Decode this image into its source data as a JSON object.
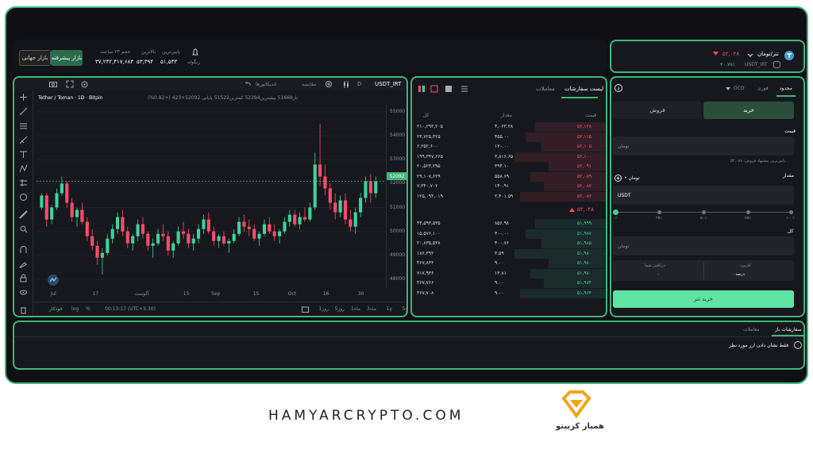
{
  "topbar": {
    "market_global": "بازار جهانی",
    "market_pro": "بازار پیشرفته",
    "vol_label": "حجم ۲۴ ساعت",
    "vol": "۳۷,۲۴۲,۴۱۷,۶۸۳",
    "high_label": "بالاترین",
    "high": "۵۳,۳۹۴",
    "low_label": "پایین‌ترین",
    "low": "۵۱,۵۳۳",
    "wallet": "زنگوله"
  },
  "pair": {
    "name": "تتر/تومان",
    "code": "USDT_IRT",
    "price": "۵۲,۰۲۸",
    "change": "+۰.۷۸٪"
  },
  "chart": {
    "symbol": "USDT_IRT",
    "interval": "D",
    "compare": "مقایسه",
    "indicators": "اندیکاتورها",
    "title": "Tether / Toman · 1D · Bitpin",
    "ohlc_prefix": "باز",
    "ohlc": "باز51669 بیشترین52294 کمترین51522 پایانی 52092+423 (+0.82%)",
    "last": "52092",
    "yticks": [
      "55000",
      "54000",
      "53000",
      "52000",
      "51000",
      "50000",
      "49000",
      "48000"
    ],
    "xticks": [
      "Jul",
      "17",
      "آگوست",
      "15",
      "Sep",
      "15",
      "Oct",
      "16",
      "30"
    ],
    "ranges": [
      "5y",
      "1y",
      "3ماه",
      "1ماه",
      "5روز",
      "1روز"
    ],
    "time": "00:13:17 (UTC+3:30)",
    "opts": [
      "%",
      "log",
      "خودکار"
    ],
    "candles": [
      [
        51.0,
        51.6,
        50.9,
        51.5
      ],
      [
        51.5,
        51.6,
        50.2,
        50.5
      ],
      [
        50.5,
        51.1,
        50.3,
        51.0
      ],
      [
        51.0,
        51.8,
        50.9,
        51.6
      ],
      [
        51.6,
        52.3,
        51.5,
        52.0
      ],
      [
        52.0,
        52.1,
        51.0,
        51.2
      ],
      [
        51.2,
        51.4,
        50.4,
        50.6
      ],
      [
        50.6,
        51.0,
        50.2,
        50.9
      ],
      [
        50.9,
        51.2,
        50.3,
        50.4
      ],
      [
        50.4,
        50.6,
        49.6,
        49.8
      ],
      [
        49.8,
        50.1,
        49.2,
        49.4
      ],
      [
        49.4,
        49.6,
        48.6,
        48.9
      ],
      [
        48.9,
        49.3,
        48.2,
        49.1
      ],
      [
        49.1,
        49.9,
        49.0,
        49.7
      ],
      [
        49.7,
        50.3,
        49.5,
        50.1
      ],
      [
        50.1,
        50.8,
        49.9,
        50.6
      ],
      [
        50.6,
        50.9,
        49.8,
        50.0
      ],
      [
        50.0,
        50.2,
        49.3,
        49.5
      ],
      [
        49.5,
        49.9,
        49.2,
        49.8
      ],
      [
        49.8,
        50.5,
        49.6,
        50.3
      ],
      [
        50.3,
        50.6,
        49.7,
        49.9
      ],
      [
        49.9,
        50.0,
        49.2,
        49.4
      ],
      [
        49.4,
        49.7,
        48.9,
        49.5
      ],
      [
        49.5,
        50.1,
        49.4,
        49.9
      ],
      [
        49.9,
        50.3,
        49.6,
        49.8
      ],
      [
        49.8,
        50.0,
        49.0,
        49.2
      ],
      [
        49.2,
        49.6,
        48.9,
        49.5
      ],
      [
        49.5,
        50.2,
        49.4,
        50.0
      ],
      [
        50.0,
        50.4,
        49.7,
        49.9
      ],
      [
        49.9,
        50.1,
        49.3,
        49.5
      ],
      [
        49.5,
        49.9,
        49.2,
        49.7
      ],
      [
        49.7,
        50.3,
        49.5,
        50.1
      ],
      [
        50.1,
        50.7,
        49.9,
        50.5
      ],
      [
        50.5,
        50.8,
        49.9,
        50.0
      ],
      [
        50.0,
        50.2,
        49.4,
        49.6
      ],
      [
        49.6,
        49.9,
        49.3,
        49.8
      ],
      [
        49.8,
        50.0,
        49.4,
        49.5
      ],
      [
        49.5,
        49.7,
        49.1,
        49.6
      ],
      [
        49.6,
        50.1,
        49.5,
        49.9
      ],
      [
        49.9,
        50.6,
        49.8,
        50.4
      ],
      [
        50.4,
        50.7,
        50.0,
        50.2
      ],
      [
        50.2,
        50.5,
        49.8,
        50.1
      ],
      [
        50.1,
        50.3,
        49.6,
        49.7
      ],
      [
        49.7,
        50.0,
        49.4,
        49.9
      ],
      [
        49.9,
        50.5,
        49.8,
        50.3
      ],
      [
        50.3,
        50.6,
        49.9,
        50.0
      ],
      [
        50.0,
        50.3,
        49.6,
        49.8
      ],
      [
        49.8,
        50.1,
        49.5,
        50.0
      ],
      [
        50.0,
        50.6,
        49.9,
        50.4
      ],
      [
        50.4,
        50.9,
        50.2,
        50.7
      ],
      [
        50.7,
        50.9,
        50.2,
        50.3
      ],
      [
        50.3,
        50.8,
        50.1,
        50.6
      ],
      [
        50.6,
        51.0,
        50.4,
        50.5
      ],
      [
        50.5,
        51.2,
        50.4,
        51.0
      ],
      [
        51.0,
        53.3,
        50.9,
        52.8
      ],
      [
        52.8,
        54.5,
        51.9,
        52.3
      ],
      [
        52.3,
        52.8,
        51.5,
        51.8
      ],
      [
        51.8,
        52.0,
        50.9,
        51.2
      ],
      [
        51.2,
        51.6,
        50.5,
        50.8
      ],
      [
        50.8,
        51.5,
        50.6,
        51.3
      ],
      [
        51.3,
        51.6,
        50.3,
        50.5
      ],
      [
        50.5,
        50.9,
        50.0,
        50.2
      ],
      [
        50.2,
        51.0,
        49.9,
        50.8
      ],
      [
        50.8,
        51.6,
        50.6,
        51.4
      ],
      [
        51.4,
        52.3,
        51.2,
        52.1
      ],
      [
        52.1,
        52.4,
        51.2,
        51.6
      ],
      [
        51.6,
        52.3,
        51.4,
        52.09
      ]
    ]
  },
  "orderbook": {
    "tab_book": "لیست سفارشات",
    "tab_trades": "معاملات",
    "col_price": "قیمت",
    "col_amount": "مقدار",
    "col_total": "کل",
    "mid": "۵۲,۰۲۸",
    "asks": [
      [
        "۵۲,۱۲۸",
        "۴,۰۶۳.۲۸",
        "۲۱۰,۲۹۳,۲۰۵"
      ],
      [
        "۵۲,۱۱۵",
        "۴۵۵.۰۰",
        "۲۳,۷۲۵,۳۲۵"
      ],
      [
        "۵۲,۱۰۵",
        "۱۲۰.۰۰",
        "۶,۲۵۲,۶۰۰"
      ],
      [
        "۵۲,۱۰۰",
        "۳,۸۱۶.۶۵",
        "۱۹۹,۳۴۷,۶۶۵"
      ],
      [
        "۵۲,۰۹۱",
        "۳۹۴.۱۰",
        "۲۰,۵۲۳,۲۹۵"
      ],
      [
        "۵۲,۰۸۹",
        "۵۵۸.۶۹",
        "۲۹,۱۰۷,۶۲۹"
      ],
      [
        "۵۲,۰۸۷",
        "۱۴۰.۹۱",
        "۷,۳۴۰,۷۰۲"
      ],
      [
        "۵۲,۰۸۶",
        "۲,۴۰۱.۵۹",
        "۱۲۵,۰۹۴,۰۱۹"
      ]
    ],
    "bids": [
      [
        "۵۱,۹۹۹",
        "۸۵۶.۹۸",
        "۴۴,۵۹۳,۵۳۵"
      ],
      [
        "۵۱,۹۸۷",
        "۳۰۰.۰۰",
        "۱۵,۵۷۶,۱۰۰"
      ],
      [
        "۵۱,۹۸۵",
        "۴۰۰.۷۶",
        "۲۰,۸۳۵,۵۳۸"
      ],
      [
        "۵۱,۹۸۰",
        "۳.۵۹",
        "۱۸۶,۳۹۲"
      ],
      [
        "۵۱,۹۸۰",
        "۹.۰۰",
        "۴۶۷,۸۴۴"
      ],
      [
        "۵۱,۹۸۰",
        "۱۳.۸۱",
        "۷۱۷,۹۳۶"
      ],
      [
        "۵۱,۹۷۴",
        "۹.۰۰",
        "۴۶۷,۷۶۶"
      ],
      [
        "۵۱,۹۶۴",
        "۹.۰۰",
        "۴۶۷,۷۰۸"
      ]
    ]
  },
  "trade": {
    "tab_market": "فوری",
    "tab_limit": "محدود",
    "oco": "OCO",
    "buy": "خرید",
    "sell": "فروش",
    "price_label": "قیمت",
    "price_unit": "تومان",
    "best_hint": "پایین‌ترین پیشنهاد فروش: ۵۲,۰۸۸",
    "amount_label": "مقدار",
    "amount_unit": "USDT",
    "toman": "• تومان",
    "pct": [
      "۰٪",
      "۲۵٪",
      "۵۰٪",
      "۷۵٪",
      "۱۰۰٪"
    ],
    "total_label": "کل",
    "total_unit": "تومان",
    "fee_label": "کارمزد",
    "fee_val": "۰ درصد",
    "recv_label": "دریافتی شما",
    "recv_val": "۰",
    "submit": "خرید تتر"
  },
  "orders": {
    "tab_open": "سفارشات باز",
    "tab_trades": "معاملات",
    "filter": "فقط نشان دادن ارز مورد نظر"
  },
  "footer": {
    "brand": "HAMYARCRYPTO.COM",
    "logo_text": "همیار کریپتو"
  },
  "colors": {
    "accent": "#3fb57a",
    "up": "#3fd39a",
    "down": "#ff4d6a"
  }
}
